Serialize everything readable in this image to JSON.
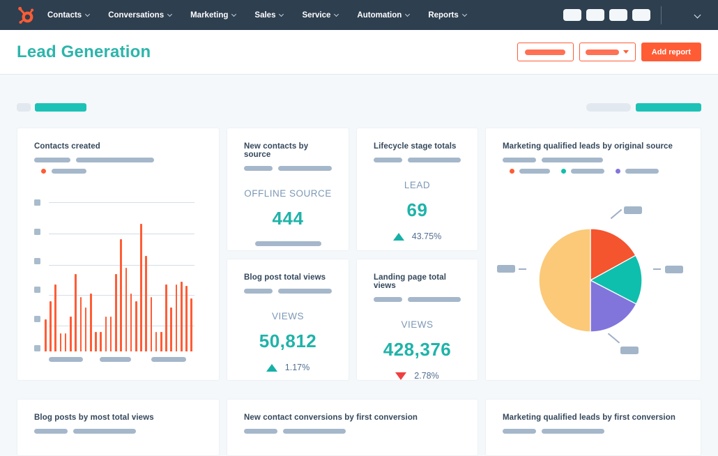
{
  "nav": {
    "items": [
      {
        "label": "Contacts"
      },
      {
        "label": "Conversations"
      },
      {
        "label": "Marketing"
      },
      {
        "label": "Sales"
      },
      {
        "label": "Service"
      },
      {
        "label": "Automation"
      },
      {
        "label": "Reports"
      }
    ]
  },
  "header": {
    "title": "Lead Generation",
    "add_report_label": "Add report"
  },
  "cards": {
    "contacts_created": {
      "title": "Contacts created"
    },
    "new_contacts_by_source": {
      "title": "New contacts by source",
      "metric_label": "OFFLINE SOURCE",
      "value": "444"
    },
    "lifecycle_stage_totals": {
      "title": "Lifecycle stage totals",
      "metric_label": "LEAD",
      "value": "69",
      "delta": "43.75%",
      "delta_direction": "up"
    },
    "mql_by_original_source": {
      "title": "Marketing qualified leads by original source"
    },
    "blog_post_total_views": {
      "title": "Blog post total views",
      "metric_label": "VIEWS",
      "value": "50,812",
      "delta": "1.17%",
      "delta_direction": "up"
    },
    "landing_page_total_views": {
      "title": "Landing page total views",
      "metric_label": "VIEWS",
      "value": "428,376",
      "delta": "2.78%",
      "delta_direction": "down"
    },
    "blog_posts_by_most_total_views": {
      "title": "Blog posts by most total views"
    },
    "new_contact_conversions_by_first_conversion": {
      "title": "New contact conversions by first conversion"
    },
    "mql_by_first_conversion": {
      "title": "Marketing qualified leads by first conversion"
    }
  },
  "chart_data": [
    {
      "type": "bar",
      "title": "Contacts created",
      "xlabel": "",
      "ylabel": "",
      "axis_tick_labels": "skeleton placeholders (no text rendered)",
      "color": "#ff5c35",
      "values_pct_of_plot_height": [
        21,
        33,
        44,
        12,
        12,
        23,
        51,
        36,
        29,
        38,
        13,
        13,
        23,
        23,
        51,
        74,
        55,
        38,
        33,
        84,
        63,
        36,
        13,
        13,
        44,
        29,
        44,
        46,
        43,
        35
      ]
    },
    {
      "type": "pie",
      "title": "Marketing qualified leads by original source",
      "legend": "three skeleton placeholder entries with colored dots",
      "slices": [
        {
          "pct": 17.0,
          "color": "#f4542e"
        },
        {
          "pct": 15.6,
          "color": "#0fbfad"
        },
        {
          "pct": 17.4,
          "color": "#8175dc"
        },
        {
          "pct": 50.0,
          "color": "#fbc978"
        }
      ]
    }
  ],
  "colors": {
    "navbar_bg": "#2e3f50",
    "accent_teal_text": "#1fb3a9",
    "accent_teal_pill": "#1dc2b6",
    "primary_orange": "#ff5c35",
    "skeleton_blue_gray": "#a5b7ca",
    "skeleton_light_gray": "#e2e8ef",
    "positive_delta": "#17b0a7",
    "negative_delta": "#ef4040",
    "card_title": "#33475b",
    "muted_label": "#7c98b6"
  }
}
